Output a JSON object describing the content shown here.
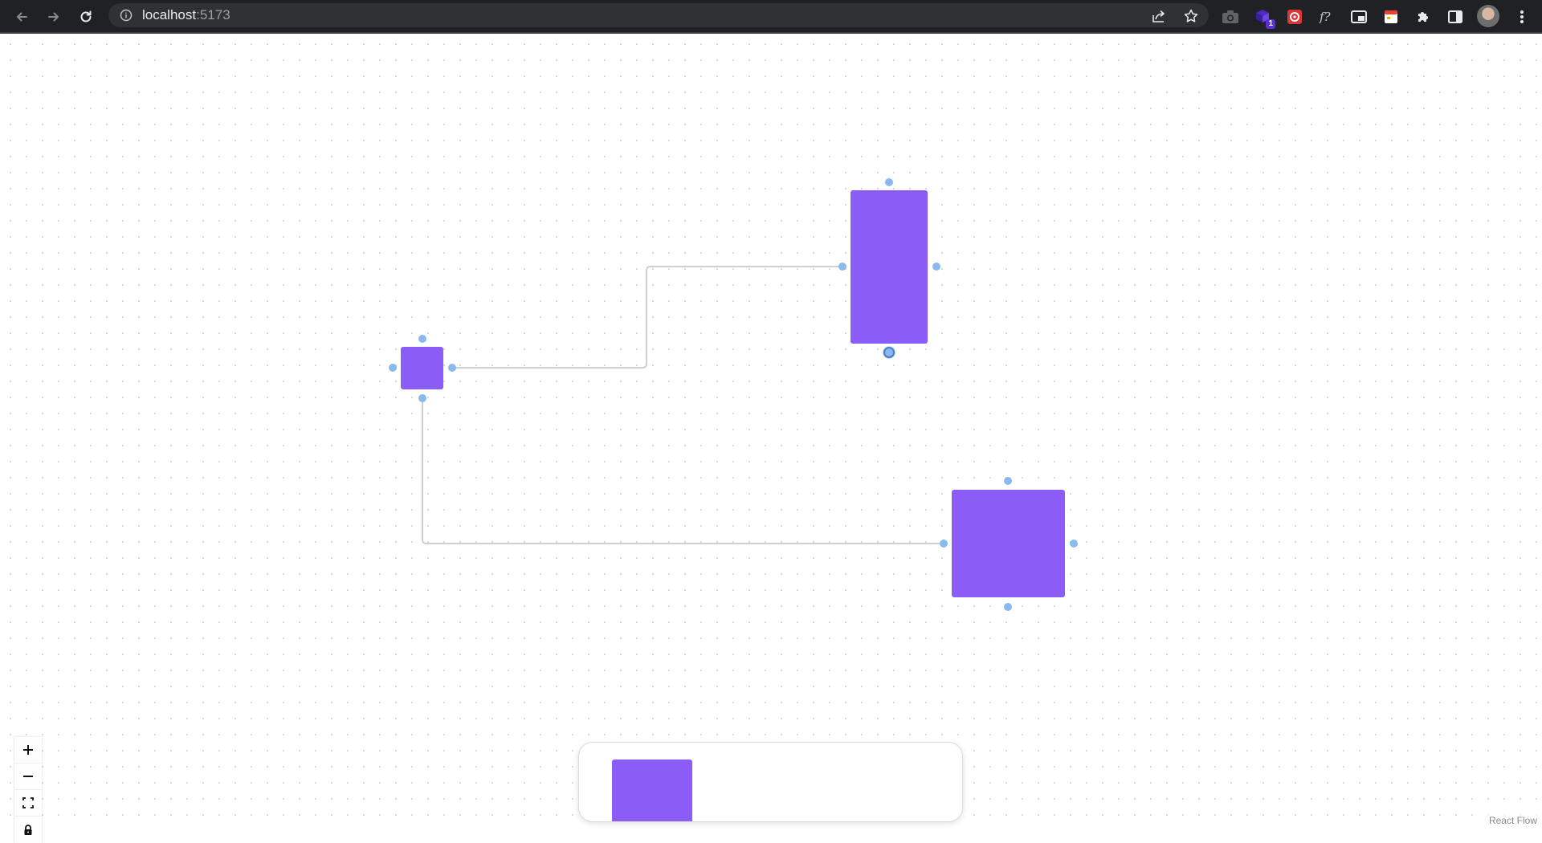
{
  "browser": {
    "url_host": "localhost",
    "url_port": ":5173",
    "extension_badge": "1",
    "icons": [
      "back-arrow-icon",
      "forward-arrow-icon",
      "reload-icon",
      "info-icon",
      "share-icon",
      "star-icon",
      "camera-icon",
      "extension-icon",
      "extension-icon",
      "formula-icon",
      "picture-in-picture-icon",
      "calendar-icon",
      "puzzle-icon",
      "side-panel-icon",
      "kebab-menu-icon"
    ]
  },
  "canvas": {
    "background": "dots",
    "node_color": "#8b5cf6",
    "handle_color": "#8ab8f0",
    "edge_color": "#cfcfcf"
  },
  "controls": {
    "icons": [
      "zoom-in-icon",
      "zoom-out-icon",
      "fit-view-icon",
      "lock-icon"
    ]
  },
  "attribution": "React Flow"
}
